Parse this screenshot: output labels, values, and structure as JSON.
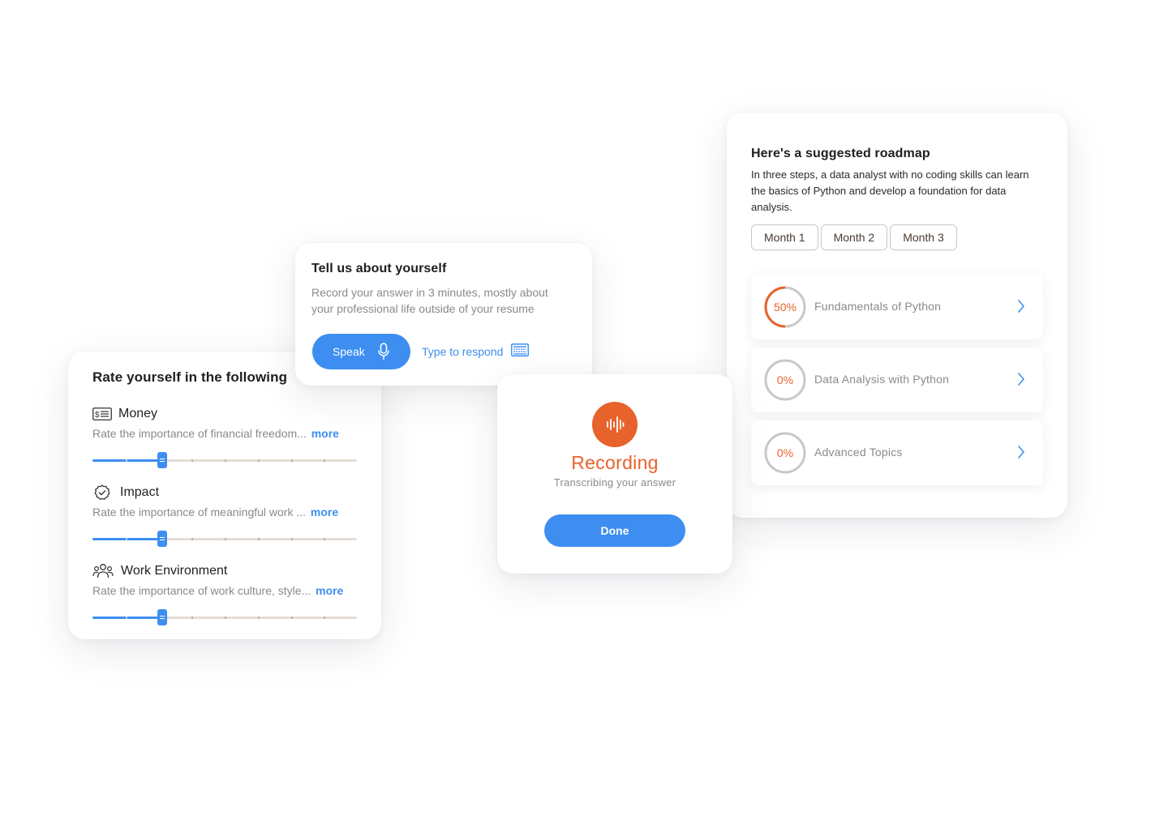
{
  "rate_card": {
    "title": "Rate yourself in the following",
    "items": [
      {
        "label": "Money",
        "icon": "money-icon",
        "description": "Rate the importance of financial freedom...",
        "more": "more",
        "value_fraction": 0.265
      },
      {
        "label": "Impact",
        "icon": "badge-check-icon",
        "description": "Rate the importance of meaningful work ...",
        "more": "more",
        "value_fraction": 0.265
      },
      {
        "label": "Work Environment",
        "icon": "people-group-icon",
        "description": "Rate the importance of work culture, style...",
        "more": "more",
        "value_fraction": 0.265
      }
    ]
  },
  "tell_card": {
    "title": "Tell us about yourself",
    "description": "Record your answer in 3 minutes, mostly about your professional life outside of your resume",
    "speak_label": "Speak",
    "type_label": "Type to respond"
  },
  "recording_card": {
    "title": "Recording",
    "subtitle": "Transcribing your answer",
    "done_label": "Done"
  },
  "roadmap_card": {
    "title": "Here's a suggested roadmap",
    "description": "In three steps, a data analyst with no coding skills can learn the basics of Python and develop a foundation for data analysis.",
    "months": [
      "Month 1",
      "Month 2",
      "Month 3"
    ],
    "steps": [
      {
        "percent_label": "50%",
        "progress": 0.5,
        "name": "Fundamentals of Python"
      },
      {
        "percent_label": "0%",
        "progress": 0,
        "name": "Data Analysis with Python"
      },
      {
        "percent_label": "0%",
        "progress": 0,
        "name": "Advanced Topics"
      }
    ]
  },
  "colors": {
    "accent_blue": "#3d8ef0",
    "accent_orange": "#e8622c",
    "ring_gray": "#c8c8c8",
    "muted_text": "#8a8a8a"
  }
}
